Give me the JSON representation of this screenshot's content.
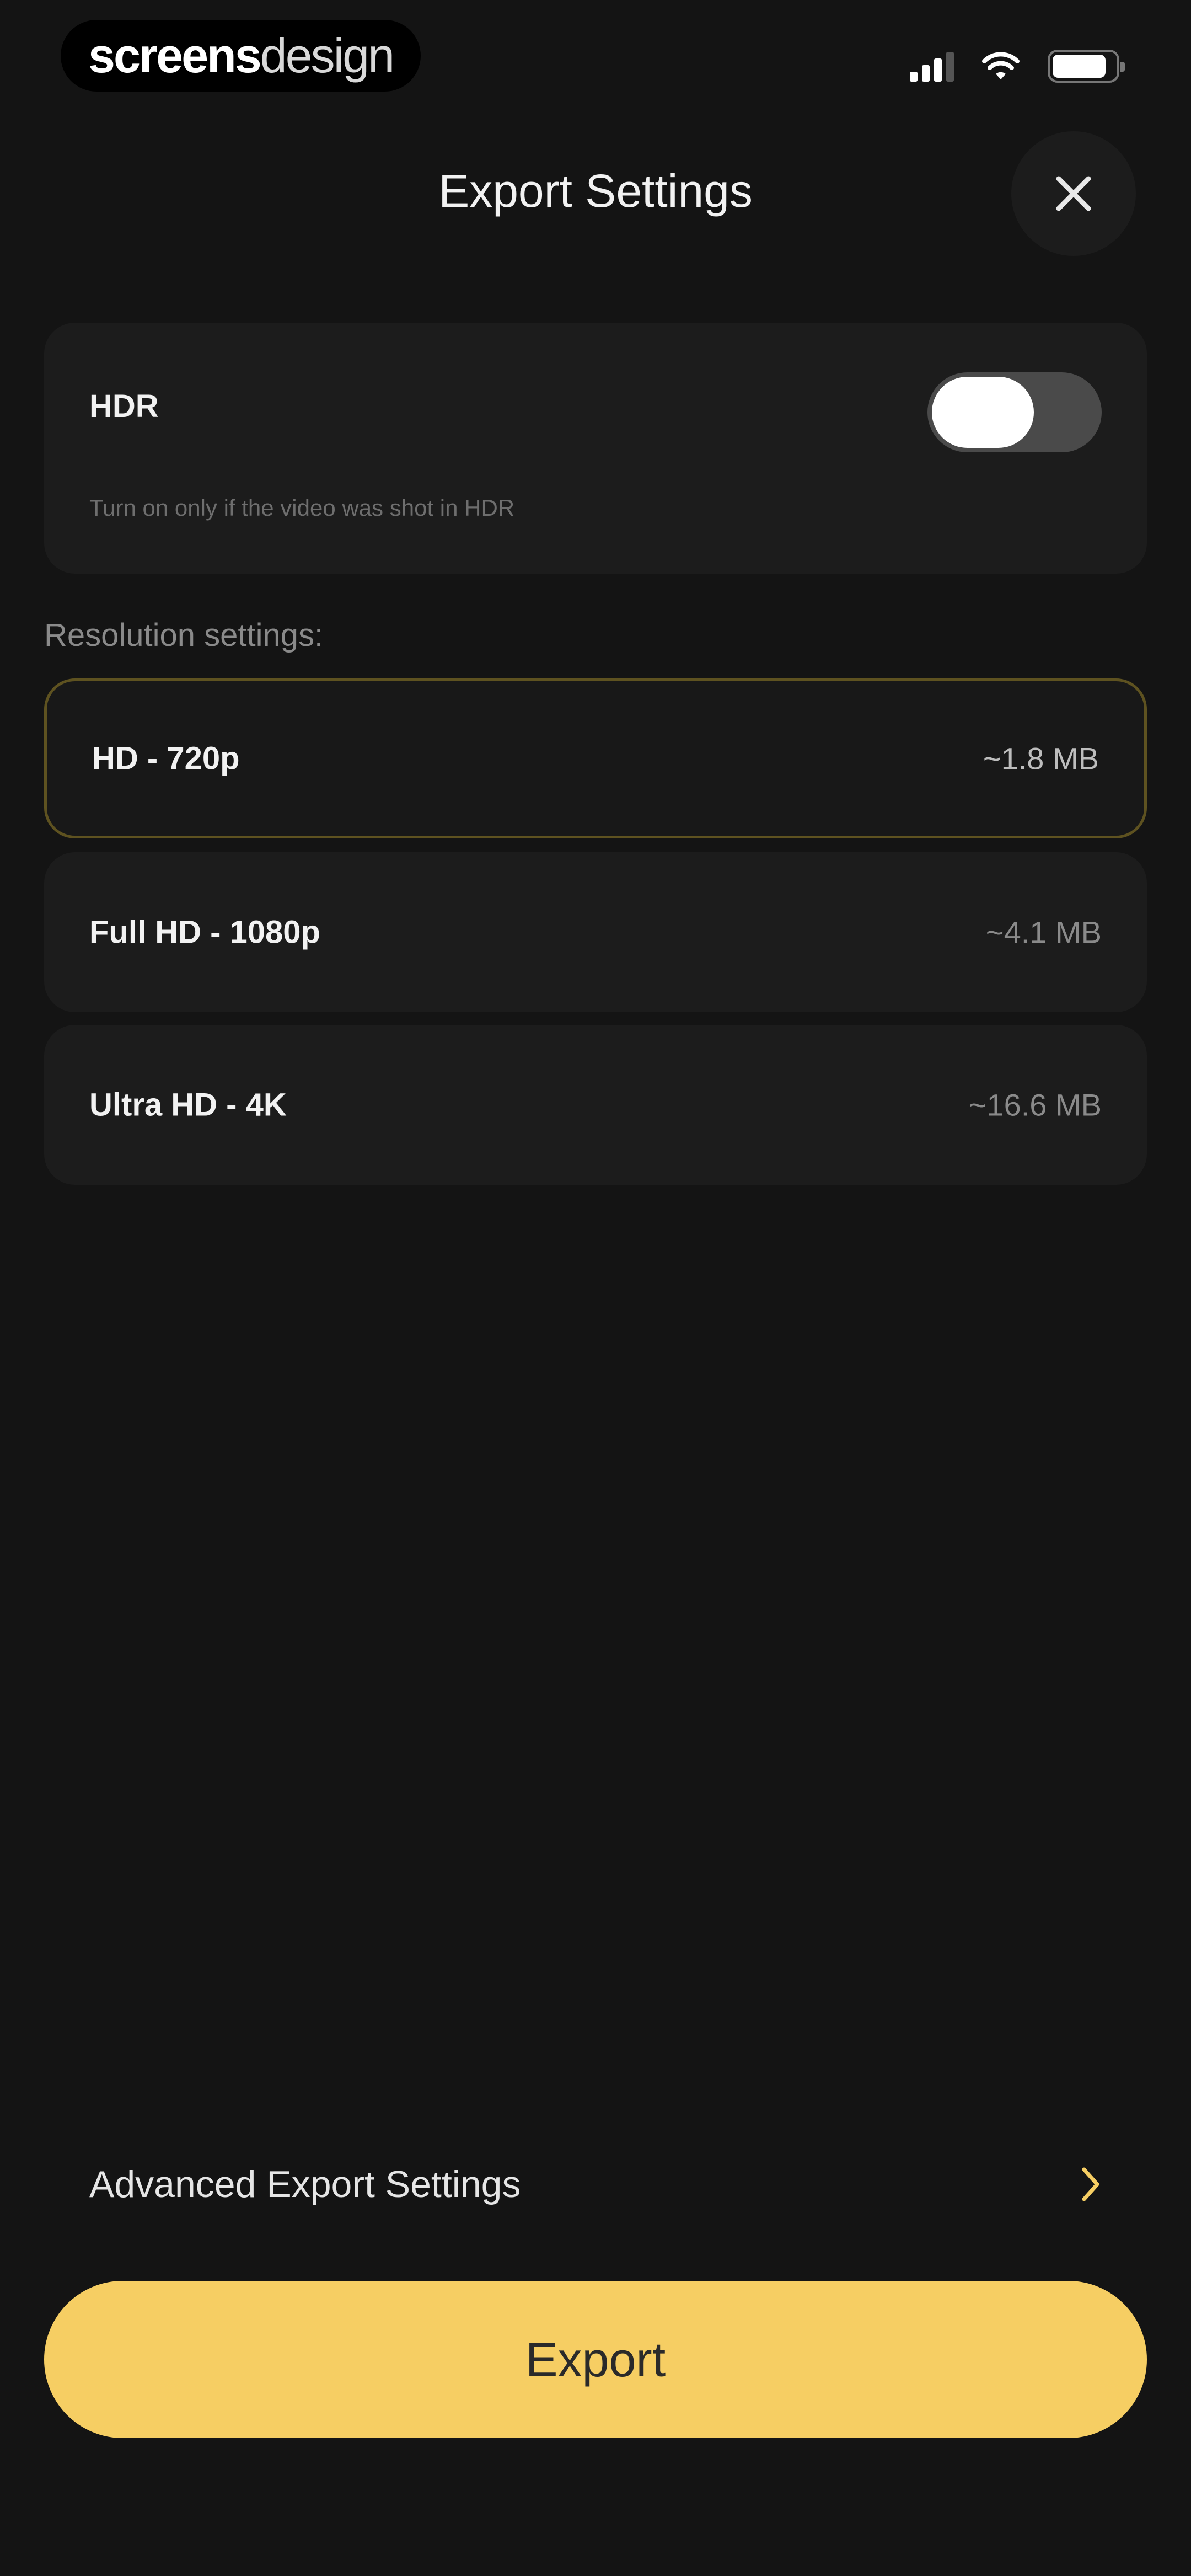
{
  "status_bar": {
    "brand_bold": "screens",
    "brand_regular": "design",
    "signal_icon": "signal-icon",
    "wifi_icon": "wifi-icon",
    "battery_icon": "battery-icon",
    "battery_level": 0.86
  },
  "header": {
    "title": "Export Settings",
    "close_icon": "close-icon"
  },
  "hdr": {
    "label": "HDR",
    "hint": "Turn on only if the video was shot in HDR",
    "enabled": false
  },
  "resolution": {
    "section_label": "Resolution settings:",
    "options": [
      {
        "name": "HD - 720p",
        "size": "~1.8 MB",
        "selected": true
      },
      {
        "name": "Full HD - 1080p",
        "size": "~4.1 MB",
        "selected": false
      },
      {
        "name": "Ultra HD - 4K",
        "size": "~16.6 MB",
        "selected": false
      }
    ]
  },
  "advanced": {
    "label": "Advanced Export Settings",
    "chevron_icon": "chevron-right-icon"
  },
  "export_button": {
    "label": "Export"
  },
  "colors": {
    "background": "#141414",
    "card": "#1c1c1c",
    "accent": "#f6ce63",
    "selected_border": "#5e5220"
  }
}
